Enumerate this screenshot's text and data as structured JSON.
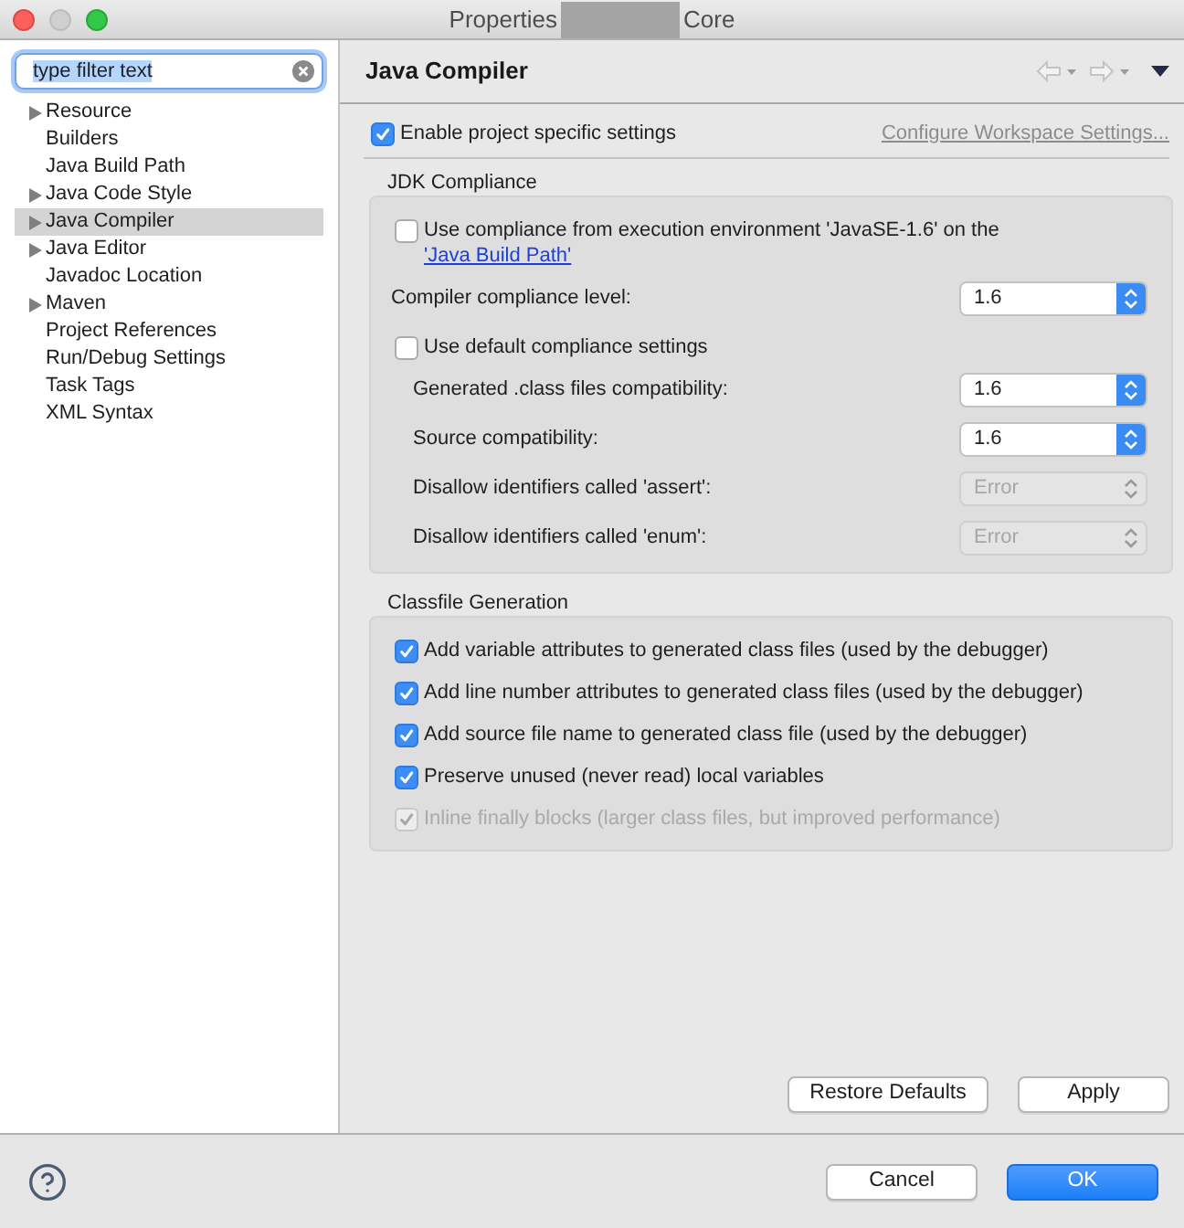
{
  "window": {
    "title_start": "Properties",
    "title_end": "Core"
  },
  "sidebar": {
    "filter": {
      "value": "type filter text",
      "text_selected": true
    },
    "items": [
      {
        "label": "Resource",
        "expandable": true,
        "selected": false
      },
      {
        "label": "Builders",
        "expandable": false,
        "selected": false
      },
      {
        "label": "Java Build Path",
        "expandable": false,
        "selected": false
      },
      {
        "label": "Java Code Style",
        "expandable": true,
        "selected": false
      },
      {
        "label": "Java Compiler",
        "expandable": true,
        "selected": true
      },
      {
        "label": "Java Editor",
        "expandable": true,
        "selected": false
      },
      {
        "label": "Javadoc Location",
        "expandable": false,
        "selected": false
      },
      {
        "label": "Maven",
        "expandable": true,
        "selected": false
      },
      {
        "label": "Project References",
        "expandable": false,
        "selected": false
      },
      {
        "label": "Run/Debug Settings",
        "expandable": false,
        "selected": false
      },
      {
        "label": "Task Tags",
        "expandable": false,
        "selected": false
      },
      {
        "label": "XML Syntax",
        "expandable": false,
        "selected": false
      }
    ]
  },
  "page": {
    "title": "Java Compiler",
    "navigation": {
      "back_disabled": true,
      "forward_disabled": true
    },
    "enable_option": {
      "label": "Enable project specific settings",
      "checked": true
    },
    "configure_link": {
      "label": "Configure Workspace Settings...",
      "disabled": true
    },
    "jdk_compliance": {
      "title": "JDK Compliance",
      "rows": [
        {
          "kind": "checkbox",
          "label": "Use compliance from execution environment 'JavaSE-1.6' on the",
          "link": "'Java Build Path'",
          "checked": false
        },
        {
          "kind": "select",
          "label": "Compiler compliance level:",
          "value": "1.6",
          "disabled": false
        },
        {
          "kind": "checkbox",
          "label": "Use default compliance settings",
          "checked": false,
          "children": [
            {
              "kind": "select",
              "label": "Generated .class files compatibility:",
              "value": "1.6",
              "disabled": false
            },
            {
              "kind": "select",
              "label": "Source compatibility:",
              "value": "1.6",
              "disabled": false
            },
            {
              "kind": "select",
              "label": "Disallow identifiers called 'assert':",
              "value": "Error",
              "disabled": true
            },
            {
              "kind": "select",
              "label": "Disallow identifiers called 'enum':",
              "value": "Error",
              "disabled": true
            }
          ]
        }
      ]
    },
    "classfile_generation": {
      "title": "Classfile Generation",
      "options": [
        {
          "label": "Add variable attributes to generated class files (used by the debugger)",
          "checked": true,
          "disabled": false
        },
        {
          "label": "Add line number attributes to generated class files (used by the debugger)",
          "checked": true,
          "disabled": false
        },
        {
          "label": "Add source file name to generated class file (used by the debugger)",
          "checked": true,
          "disabled": false
        },
        {
          "label": "Preserve unused (never read) local variables",
          "checked": true,
          "disabled": false
        },
        {
          "label": "Inline finally blocks (larger class files, but improved performance)",
          "checked": true,
          "disabled": true
        }
      ]
    },
    "buttons": [
      "Restore Defaults",
      "Apply"
    ]
  },
  "dialog_buttons": [
    {
      "label": "Cancel",
      "primary": false
    },
    {
      "label": "OK",
      "primary": true
    }
  ]
}
